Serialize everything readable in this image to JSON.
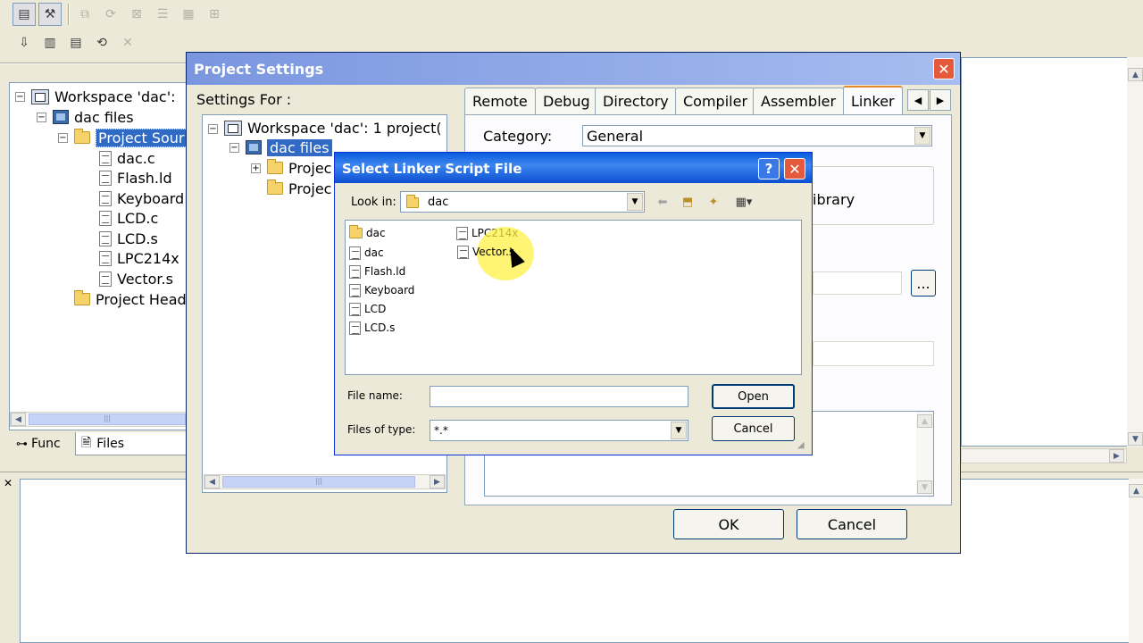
{
  "workspace_tree": {
    "items": [
      {
        "label": "Workspace 'dac':",
        "icon": "workspace-icon"
      },
      {
        "label": "dac files",
        "icon": "project-icon"
      },
      {
        "label": "Project Sour",
        "icon": "folder-icon"
      },
      {
        "label": "dac.c",
        "icon": "file-icon"
      },
      {
        "label": "Flash.ld",
        "icon": "file-icon"
      },
      {
        "label": "Keyboard",
        "icon": "file-icon"
      },
      {
        "label": "LCD.c",
        "icon": "file-icon"
      },
      {
        "label": "LCD.s",
        "icon": "file-icon"
      },
      {
        "label": "LPC214x",
        "icon": "file-icon"
      },
      {
        "label": "Vector.s",
        "icon": "file-icon"
      },
      {
        "label": "Project Head",
        "icon": "folder-icon"
      }
    ]
  },
  "bottom_tabs": {
    "func": "Func",
    "files": "Files"
  },
  "project_settings": {
    "title": "Project Settings",
    "settings_for": "Settings For :",
    "tree": [
      {
        "label": "Workspace 'dac': 1 project("
      },
      {
        "label": "dac files"
      },
      {
        "label": "Projec"
      },
      {
        "label": "Projec"
      }
    ],
    "tabs": [
      "Remote",
      "Debug",
      "Directory",
      "Compiler",
      "Assembler",
      "Linker"
    ],
    "active_tab": "Linker",
    "category_label": "Category:",
    "category_value": "General",
    "library_text": "ibrary",
    "browse_label": "...",
    "ok": "OK",
    "cancel": "Cancel"
  },
  "linker_dialog": {
    "title": "Select Linker Script File",
    "help": "?",
    "look_in_label": "Look in:",
    "look_in_value": "dac",
    "files": [
      {
        "name": "dac",
        "type": "folder"
      },
      {
        "name": "dac",
        "type": "file"
      },
      {
        "name": "Flash.ld",
        "type": "script"
      },
      {
        "name": "Keyboard",
        "type": "file"
      },
      {
        "name": "LCD",
        "type": "file"
      },
      {
        "name": "LCD.s",
        "type": "script"
      },
      {
        "name": "LPC214x",
        "type": "file"
      },
      {
        "name": "Vector.s",
        "type": "script"
      }
    ],
    "file_name_label": "File name:",
    "file_name_value": "",
    "files_of_type_label": "Files of type:",
    "files_of_type_value": "*.*",
    "open": "Open",
    "cancel": "Cancel"
  },
  "colors": {
    "xp_title_blue": "#0a5bdd",
    "inactive_title": "#7a96df",
    "selection": "#316ac5",
    "close_red": "#e55a3c",
    "cursor_highlight": "#fff046"
  }
}
